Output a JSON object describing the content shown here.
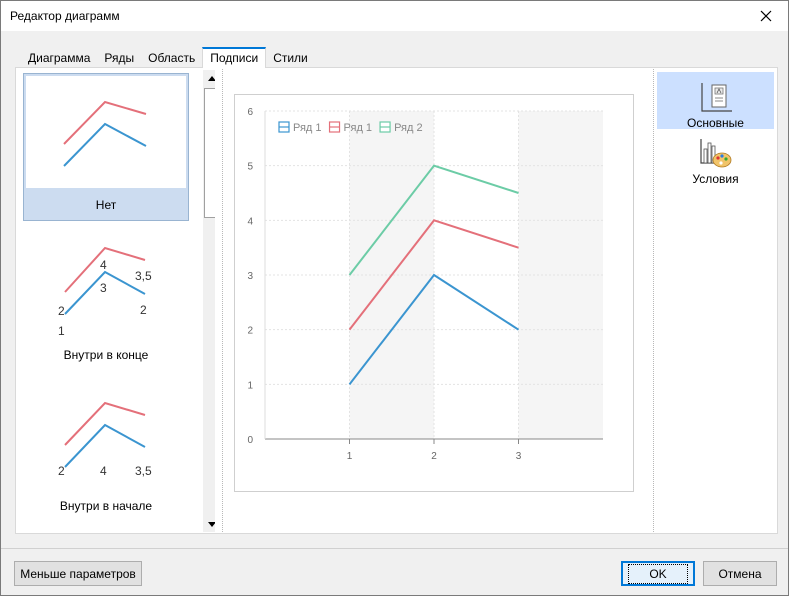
{
  "window": {
    "title": "Редактор диаграмм"
  },
  "tabs": [
    {
      "label": "Диаграмма",
      "active": false
    },
    {
      "label": "Ряды",
      "active": false
    },
    {
      "label": "Область",
      "active": false
    },
    {
      "label": "Подписи",
      "active": true
    },
    {
      "label": "Стили",
      "active": false
    }
  ],
  "label_options": [
    {
      "caption": "Нет",
      "selected": true,
      "labels": []
    },
    {
      "caption": "Внутри в конце",
      "selected": false,
      "labels": [
        "4",
        "3",
        "3,5",
        "2",
        "2",
        "1"
      ]
    },
    {
      "caption": "Внутри в начале",
      "selected": false,
      "labels": [
        "2",
        "4",
        "3,5"
      ]
    }
  ],
  "categories": [
    {
      "label": "Основные",
      "icon": "chart-layout-icon",
      "selected": true
    },
    {
      "label": "Условия",
      "icon": "chart-palette-icon",
      "selected": false
    }
  ],
  "buttons": {
    "less_params": "Меньше параметров",
    "ok": "OK",
    "cancel": "Отмена"
  },
  "chart_data": {
    "type": "line",
    "x": [
      1,
      2,
      3
    ],
    "series": [
      {
        "name": "Ряд 1",
        "values": [
          1,
          3,
          2
        ],
        "color": "#3b95d0"
      },
      {
        "name": "Ряд 1",
        "values": [
          2,
          4,
          3.5
        ],
        "color": "#e4707a"
      },
      {
        "name": "Ряд 2",
        "values": [
          3,
          5,
          4.5
        ],
        "color": "#6ccca6"
      }
    ],
    "xticks": [
      "1",
      "2",
      "3"
    ],
    "yticks": [
      "0",
      "1",
      "2",
      "3",
      "4",
      "5",
      "6"
    ],
    "xlim": [
      0,
      4
    ],
    "ylim": [
      0,
      6
    ],
    "grid": true,
    "legend_position": "top-left"
  }
}
